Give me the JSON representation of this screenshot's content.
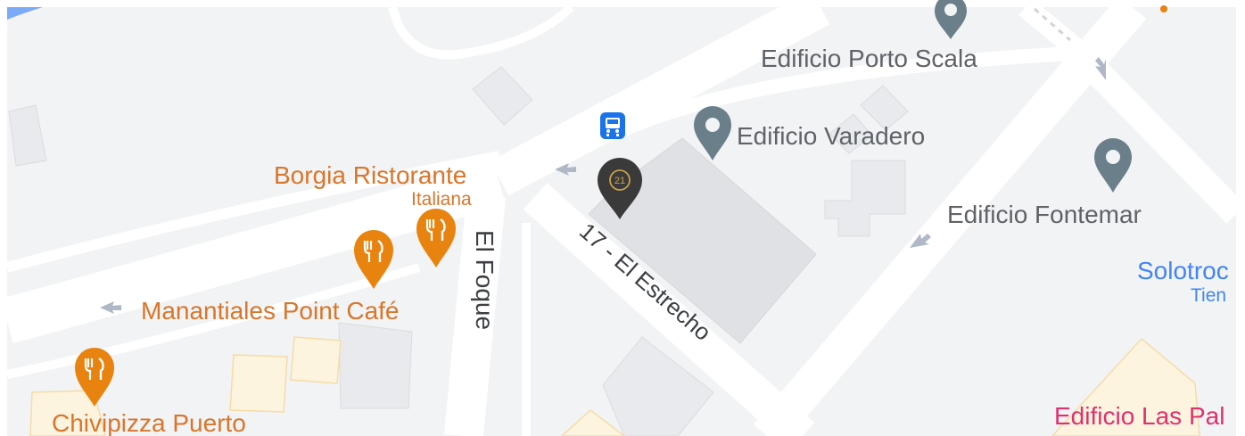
{
  "map": {
    "streets": {
      "el_foque": "El Foque",
      "el_estrecho": "17 - El Estrecho"
    },
    "places": {
      "borgia_name": "Borgia Ristorante",
      "borgia_category": "Italiana",
      "manantiales": "Manantiales Point Café",
      "chivipizza": "Chivipizza Puerto",
      "porto_scala": "Edificio Porto Scala",
      "varadero": "Edificio Varadero",
      "fontemar": "Edificio Fontemar",
      "solotrod": "Solotroc",
      "solotrod_category": "Tien",
      "las_palmas": "Edificio Las Pal"
    },
    "marker_badge": "21",
    "icons": {
      "bus": "bus-stop-icon",
      "restaurant": "restaurant-icon",
      "place_pin": "map-pin-icon",
      "selected": "selected-place-marker"
    },
    "colors": {
      "restaurant": "#e8830f",
      "pin_gray": "#6b7f8a",
      "bus": "#1a73e8",
      "marker_dark": "#3a3a3a",
      "marker_gold": "#c9a14a"
    }
  }
}
